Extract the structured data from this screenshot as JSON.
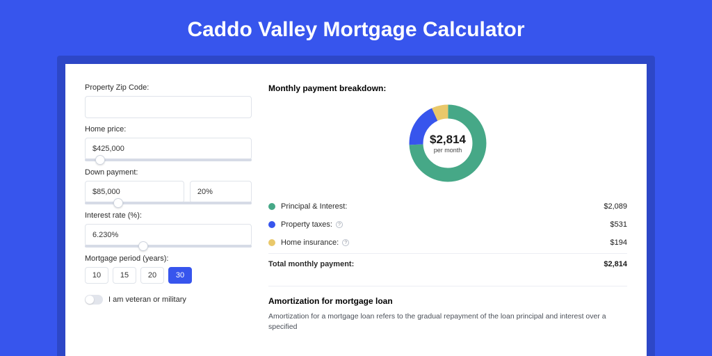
{
  "title": "Caddo Valley Mortgage Calculator",
  "colors": {
    "principal": "#46a887",
    "taxes": "#3755ed",
    "insurance": "#e9c86a"
  },
  "form": {
    "zip_label": "Property Zip Code:",
    "zip_value": "",
    "home_price_label": "Home price:",
    "home_price_value": "$425,000",
    "home_price_slider_pct": 9,
    "down_payment_label": "Down payment:",
    "down_payment_value": "$85,000",
    "down_payment_pct": "20%",
    "down_payment_slider_pct": 20,
    "interest_label": "Interest rate (%):",
    "interest_value": "6.230%",
    "interest_slider_pct": 35,
    "period_label": "Mortgage period (years):",
    "period_options": [
      "10",
      "15",
      "20",
      "30"
    ],
    "period_selected": "30",
    "veteran_label": "I am veteran or military"
  },
  "breakdown": {
    "title": "Monthly payment breakdown:",
    "center_value": "$2,814",
    "center_sub": "per month",
    "items": [
      {
        "label": "Principal & Interest:",
        "value": "$2,089",
        "color": "principal",
        "info": false
      },
      {
        "label": "Property taxes:",
        "value": "$531",
        "color": "taxes",
        "info": true
      },
      {
        "label": "Home insurance:",
        "value": "$194",
        "color": "insurance",
        "info": true
      }
    ],
    "total_label": "Total monthly payment:",
    "total_value": "$2,814"
  },
  "amortization": {
    "title": "Amortization for mortgage loan",
    "text": "Amortization for a mortgage loan refers to the gradual repayment of the loan principal and interest over a specified"
  },
  "chart_data": {
    "type": "pie",
    "title": "Monthly payment breakdown",
    "series": [
      {
        "name": "Principal & Interest",
        "value": 2089
      },
      {
        "name": "Property taxes",
        "value": 531
      },
      {
        "name": "Home insurance",
        "value": 194
      }
    ],
    "total": 2814
  }
}
